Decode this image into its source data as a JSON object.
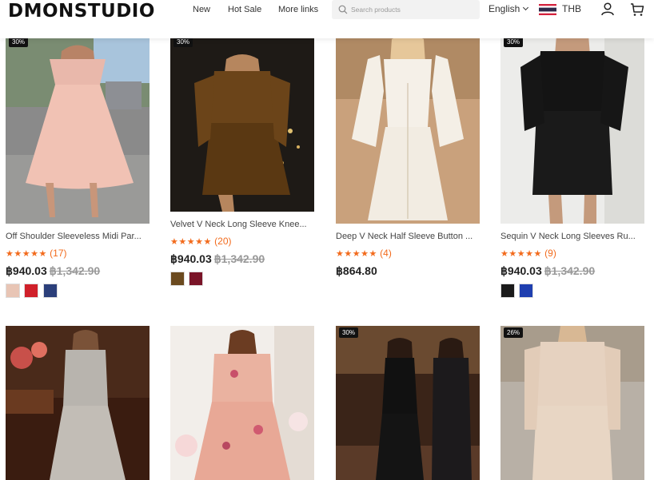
{
  "header": {
    "logo": "DMONSTUDIO",
    "nav": [
      "New",
      "Hot Sale",
      "More links"
    ],
    "search_placeholder": "Search products",
    "language": "English",
    "currency": "THB"
  },
  "products": [
    {
      "badge": "30%",
      "title": "Off Shoulder Sleeveless Midi Par...",
      "stars": "★★★★★",
      "reviews": "(17)",
      "price": "฿940.03",
      "old_price": "฿1,342.90",
      "swatches": [
        "#e8c5b5",
        "#d0202a",
        "#2b3f7a"
      ]
    },
    {
      "badge": "30%",
      "title": "Velvet V Neck Long Sleeve Knee...",
      "stars": "★★★★★",
      "reviews": "(20)",
      "price": "฿940.03",
      "old_price": "฿1,342.90",
      "swatches": [
        "#6b4a1f",
        "#7a1428"
      ]
    },
    {
      "badge": "",
      "title": "Deep V Neck Half Sleeve Button ...",
      "stars": "★★★★★",
      "reviews": "(4)",
      "price": "฿864.80",
      "old_price": "",
      "swatches": []
    },
    {
      "badge": "30%",
      "title": "Sequin V Neck Long Sleeves Ru...",
      "stars": "★★★★★",
      "reviews": "(9)",
      "price": "฿940.03",
      "old_price": "฿1,342.90",
      "swatches": [
        "#1a1a1a",
        "#1f3fb0"
      ]
    },
    {
      "badge": ""
    },
    {
      "badge": ""
    },
    {
      "badge": "30%"
    },
    {
      "badge": "26%"
    }
  ],
  "colors": {
    "accent_star": "#f26b1d",
    "price": "#222222",
    "old_price": "#999999"
  }
}
